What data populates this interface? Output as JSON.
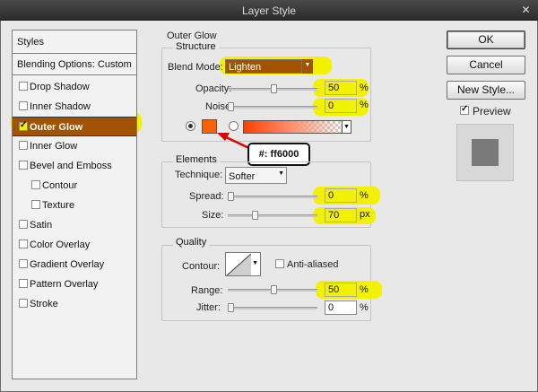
{
  "window": {
    "title": "Layer Style",
    "close_glyph": "✕"
  },
  "sidebar": {
    "header": "Styles",
    "blending_options": "Blending Options: Custom",
    "items": [
      {
        "label": "Drop Shadow",
        "checked": false
      },
      {
        "label": "Inner Shadow",
        "checked": false
      },
      {
        "label": "Outer Glow",
        "checked": true,
        "active": true
      },
      {
        "label": "Inner Glow",
        "checked": false
      },
      {
        "label": "Bevel and Emboss",
        "checked": false
      },
      {
        "label": "Contour",
        "checked": false,
        "sub": true
      },
      {
        "label": "Texture",
        "checked": false,
        "sub": true
      },
      {
        "label": "Satin",
        "checked": false
      },
      {
        "label": "Color Overlay",
        "checked": false
      },
      {
        "label": "Gradient Overlay",
        "checked": false
      },
      {
        "label": "Pattern Overlay",
        "checked": false
      },
      {
        "label": "Stroke",
        "checked": false
      }
    ]
  },
  "outer_glow": {
    "title": "Outer Glow",
    "structure": {
      "title": "Structure",
      "blend_mode_label": "Blend Mode:",
      "blend_mode_value": "Lighten",
      "opacity_label": "Opacity:",
      "opacity_value": "50",
      "opacity_fraction": 0.5,
      "noise_label": "Noise:",
      "noise_value": "0",
      "noise_fraction": 0,
      "percent": "%",
      "glow_color": "#ff6000",
      "color_callout": "#: ff6000"
    },
    "elements": {
      "title": "Elements",
      "technique_label": "Technique:",
      "technique_value": "Softer",
      "spread_label": "Spread:",
      "spread_value": "0",
      "spread_fraction": 0,
      "size_label": "Size:",
      "size_value": "70",
      "size_fraction": 0.28,
      "percent": "%",
      "px": "px"
    },
    "quality": {
      "title": "Quality",
      "contour_label": "Contour:",
      "anti_aliased_label": "Anti-aliased",
      "anti_aliased_checked": false,
      "range_label": "Range:",
      "range_value": "50",
      "range_fraction": 0.5,
      "jitter_label": "Jitter:",
      "jitter_value": "0",
      "jitter_fraction": 0,
      "percent": "%"
    }
  },
  "buttons": {
    "ok": "OK",
    "cancel": "Cancel",
    "new_style": "New Style...",
    "preview_label": "Preview",
    "preview_checked": true
  },
  "colors": {
    "highlight": "#f2f200",
    "active_row": "#a35200",
    "glow": "#ff6000",
    "arrow": "#e00000"
  }
}
